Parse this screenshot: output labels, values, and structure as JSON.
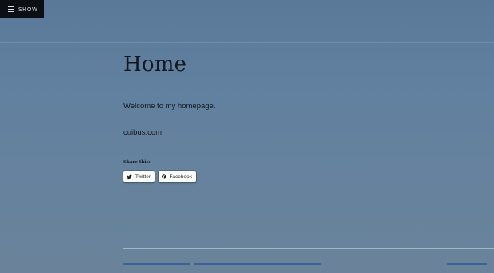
{
  "menu": {
    "label": "SHOW",
    "icon": "hamburger-menu-icon"
  },
  "page": {
    "title": "Home",
    "welcome_text": "Welcome to my homepage.",
    "site_text": "cuibus.com"
  },
  "share": {
    "heading": "Share this:",
    "buttons": [
      {
        "label": "Twitter",
        "icon": "twitter-icon"
      },
      {
        "label": "Facebook",
        "icon": "facebook-icon"
      }
    ]
  },
  "colors": {
    "background": "#5f7d9c",
    "menu_bg": "#0c0f14",
    "footer_link": "#2f5f9a",
    "twitter_icon": "#1b1f24",
    "facebook_icon": "#1b1f24"
  }
}
